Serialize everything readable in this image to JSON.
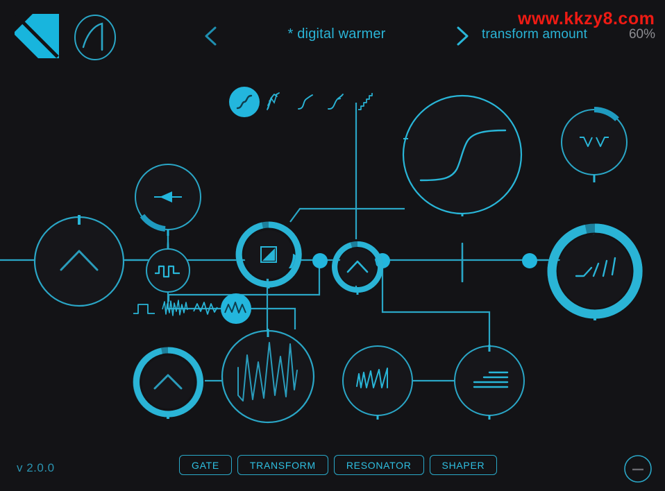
{
  "app": {
    "background_color": "#131316",
    "accent_color": "#29b6d8",
    "accent_bright": "#23b6dd",
    "muted_color": "#8d8d92"
  },
  "header": {
    "logo_name": "krotos-k-logo",
    "logo_circle_name": "concept-circle-logo",
    "prev_label": "<",
    "next_label": ">",
    "preset_name": "* digital warmer",
    "macro_label": "transform amount",
    "macro_value": "60%"
  },
  "shaper_curve_selector": {
    "name": "shaper-curve-selector",
    "selected_index": 0,
    "options": [
      {
        "label": "sigmoid-soft-curve-icon",
        "selected": true
      },
      {
        "label": "stepped-fold-curve-icon",
        "selected": false
      },
      {
        "label": "smooth-s-curve-icon",
        "selected": false
      },
      {
        "label": "asymmetric-curve-icon",
        "selected": false
      },
      {
        "label": "staircase-quantize-curve-icon",
        "selected": false
      }
    ]
  },
  "lfo_shape_selector": {
    "name": "lfo-shape-selector",
    "selected_index": 3,
    "options": [
      {
        "label": "pulse-wave-icon",
        "selected": false
      },
      {
        "label": "noise-burst-wave-icon",
        "selected": false
      },
      {
        "label": "jagged-wave-icon",
        "selected": false
      },
      {
        "label": "random-smooth-wave-icon",
        "selected": true
      }
    ]
  },
  "modules": [
    {
      "id": "input-direction-knob",
      "icon": "left-arrow-icon",
      "ring_style": "thin",
      "arc_value_pct": 22,
      "arc_position": "lower-left"
    },
    {
      "id": "pulse-shape-knob",
      "icon": "square-pulse-wave-icon",
      "ring_style": "thin",
      "arc_value_pct": 0
    },
    {
      "id": "gate-amount-knob",
      "icon": "gate-clip-square-icon",
      "ring_style": "thick",
      "arc_value_pct": 78,
      "arc_position": "top-right"
    },
    {
      "id": "transform-depth-knob",
      "icon": "chevron-up-icon",
      "ring_style": "thick",
      "arc_value_pct": 92
    },
    {
      "id": "waveshaper-display",
      "icon": "sigmoid-transfer-curve",
      "ring_style": "display",
      "arc_value_pct": 0
    },
    {
      "id": "notch-filter-knob",
      "icon": "notch-v-icon",
      "ring_style": "thin",
      "arc_value_pct": 18,
      "arc_position": "top-right"
    },
    {
      "id": "output-gain-knob",
      "icon": "chevron-up-icon",
      "ring_style": "thin",
      "arc_value_pct": 0
    },
    {
      "id": "saturation-drive-knob",
      "icon": "ascending-ramp-icon",
      "ring_style": "thick-large",
      "arc_value_pct": 88
    },
    {
      "id": "modulation-depth-knob",
      "icon": "chevron-up-icon",
      "ring_style": "thick",
      "arc_value_pct": 70,
      "arc_position": "left"
    },
    {
      "id": "lfo-display",
      "icon": "complex-lfo-waveform",
      "ring_style": "display",
      "arc_value_pct": 0
    },
    {
      "id": "resonator-knob",
      "icon": "sawtooth-decay-icon",
      "ring_style": "thin",
      "arc_value_pct": 0
    },
    {
      "id": "filter-bank-knob",
      "icon": "stacked-bars-filter-icon",
      "ring_style": "thin",
      "arc_value_pct": 0
    }
  ],
  "patch_nodes": [
    {
      "id": "patch-node-1"
    },
    {
      "id": "patch-node-2"
    },
    {
      "id": "patch-node-3"
    },
    {
      "id": "patch-node-4"
    },
    {
      "id": "patch-node-5"
    }
  ],
  "footer": {
    "version": "v 2.0.0",
    "tabs": [
      {
        "label": "GATE",
        "active": false
      },
      {
        "label": "TRANSFORM",
        "active": false
      },
      {
        "label": "RESONATOR",
        "active": false
      },
      {
        "label": "SHAPER",
        "active": false
      }
    ],
    "watermark": "www.kkzy8.com",
    "help_button_name": "help-button"
  }
}
